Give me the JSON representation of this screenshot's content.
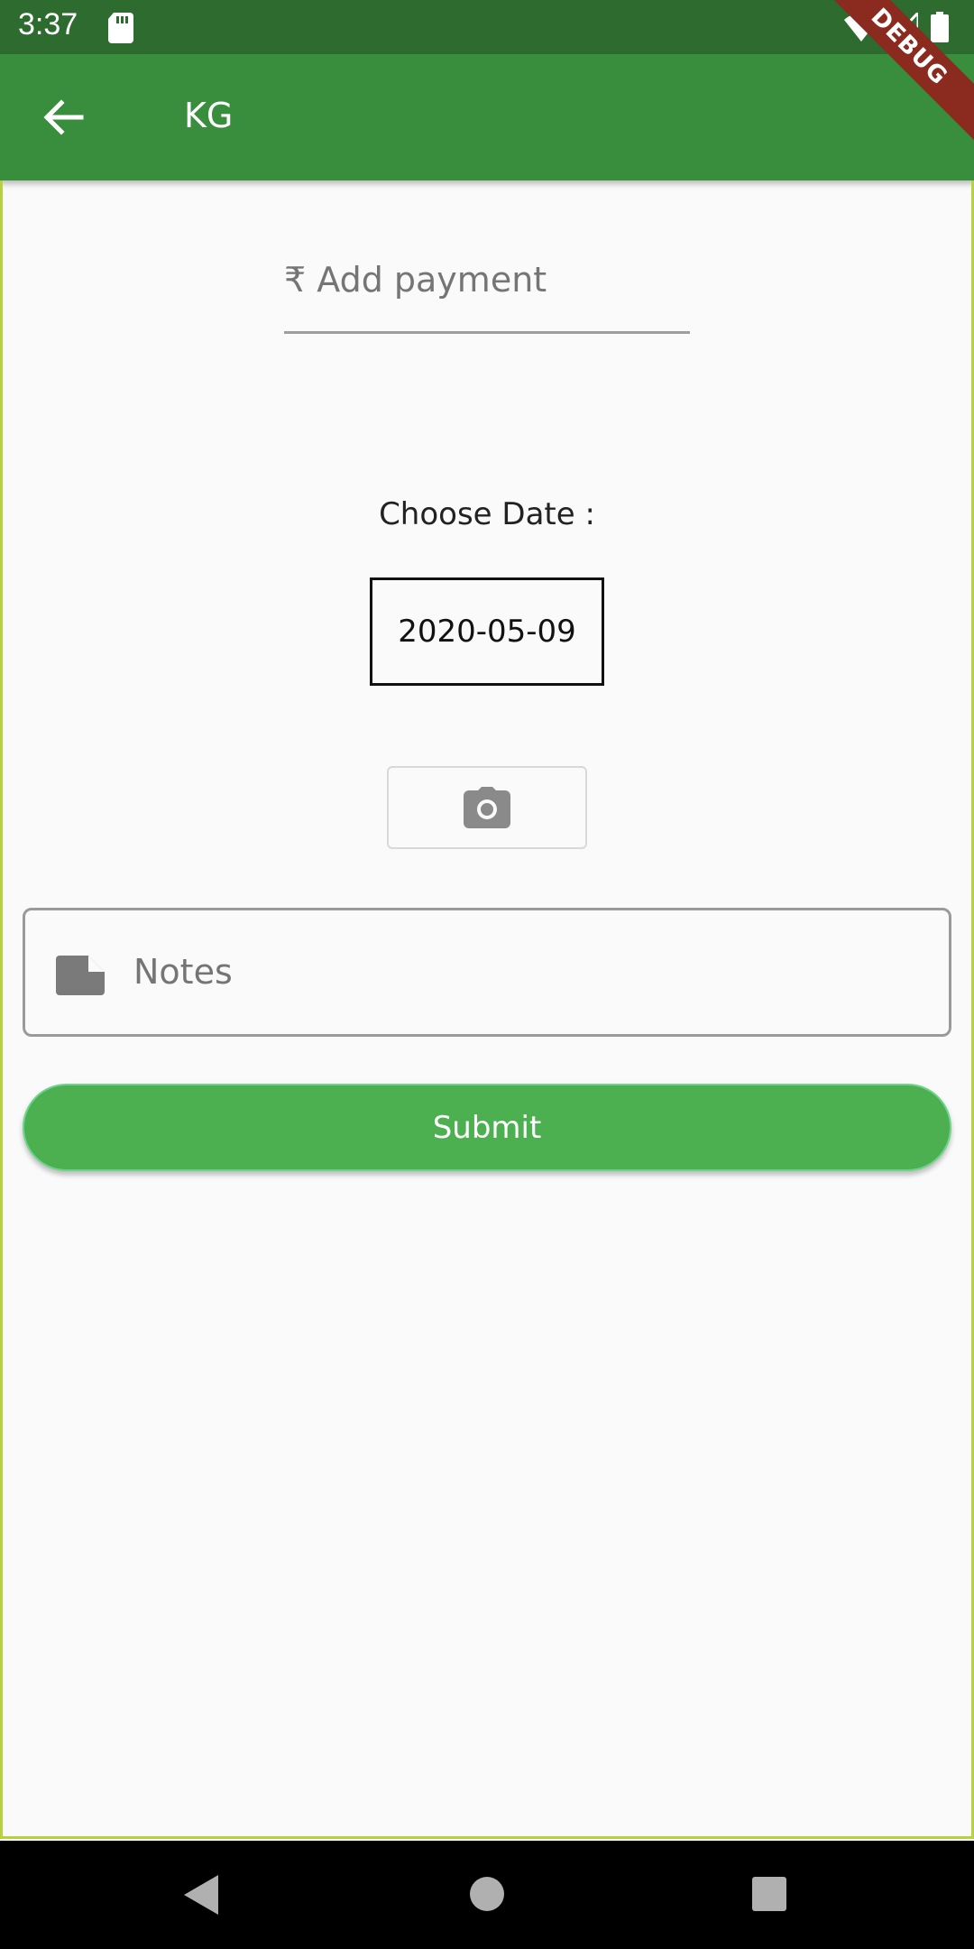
{
  "status_bar": {
    "time": "3:37"
  },
  "app_bar": {
    "title": "KG",
    "debug_label": "DEBUG"
  },
  "form": {
    "payment_placeholder": "₹ Add payment",
    "choose_date_label": "Choose Date :",
    "date_value": "2020-05-09",
    "notes_placeholder": "Notes",
    "submit_label": "Submit"
  },
  "colors": {
    "status_bar": "#2e6b2f",
    "app_bar": "#388e3c",
    "submit_button": "#4caf50"
  },
  "icons": {
    "back": "arrow-left-icon",
    "camera": "camera-icon",
    "notes": "note-icon"
  }
}
